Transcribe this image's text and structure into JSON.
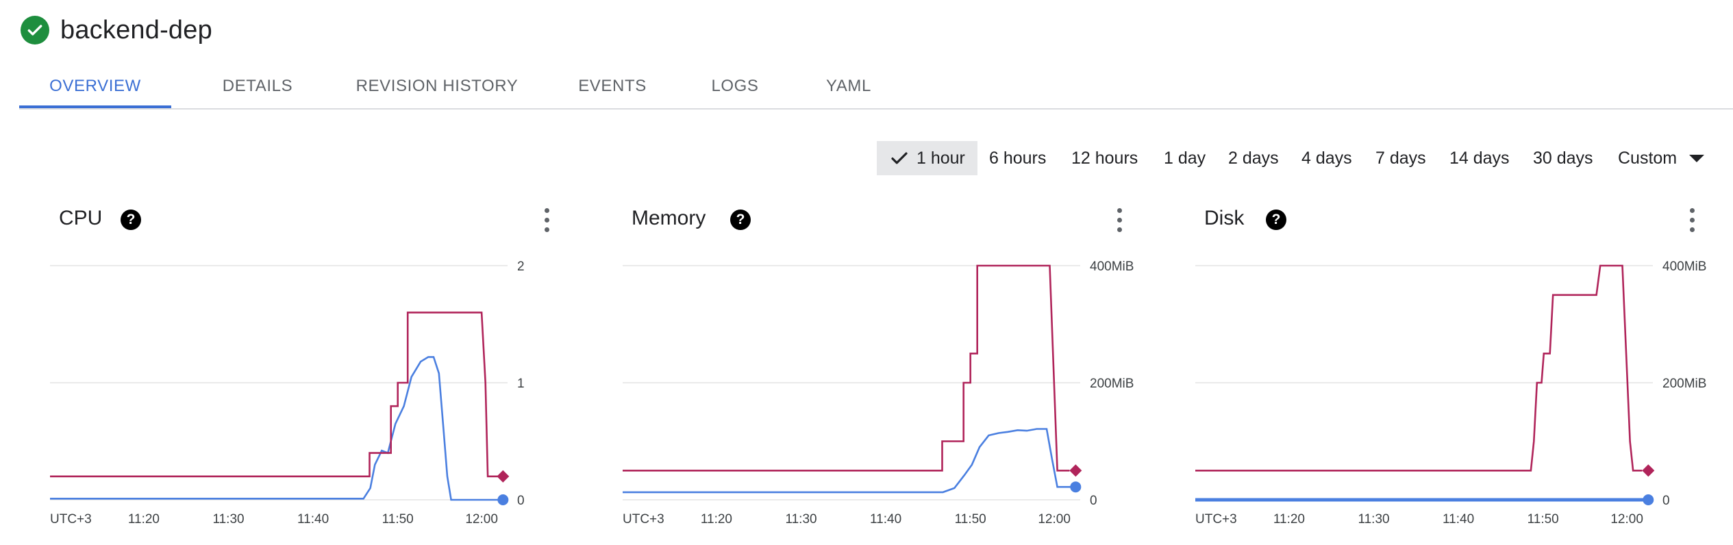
{
  "header": {
    "title": "backend-dep",
    "status_icon": "check-circle-icon",
    "status_color": "#1e8e3e"
  },
  "tabs": [
    {
      "label": "OVERVIEW",
      "active": true
    },
    {
      "label": "DETAILS"
    },
    {
      "label": "REVISION HISTORY"
    },
    {
      "label": "EVENTS"
    },
    {
      "label": "LOGS"
    },
    {
      "label": "YAML"
    }
  ],
  "time_range": {
    "selected": "1 hour",
    "options": [
      "1 hour",
      "6 hours",
      "12 hours",
      "1 day",
      "2 days",
      "4 days",
      "7 days",
      "14 days",
      "30 days",
      "Custom"
    ]
  },
  "colors": {
    "series_a": "#b0245a",
    "series_b": "#4a7fe0",
    "grid": "#e3e3e3",
    "accent": "#3b6fd4"
  },
  "chart_data": [
    {
      "type": "line",
      "title": "CPU",
      "xlabel": "UTC+3",
      "x_ticks": [
        "UTC+3",
        "11:20",
        "11:30",
        "11:40",
        "11:50",
        "12:00"
      ],
      "y_ticks": [
        "2",
        "1",
        "0"
      ],
      "ylim": [
        0,
        2
      ],
      "x_unit": "minutes",
      "xlim": [
        0,
        60
      ],
      "grid": true,
      "series": [
        {
          "values": [
            [
              0,
              0.2
            ],
            [
              41.9,
              0.2
            ],
            [
              41.9,
              0.4
            ],
            [
              44.7,
              0.4
            ],
            [
              44.7,
              0.8
            ],
            [
              45.6,
              0.8
            ],
            [
              45.6,
              1.0
            ],
            [
              46.9,
              1.0
            ],
            [
              46.9,
              1.6
            ],
            [
              56.6,
              1.6
            ],
            [
              57.1,
              1.0
            ],
            [
              57.4,
              0.2
            ],
            [
              58.7,
              0.2
            ]
          ]
        },
        {
          "values": [
            [
              0,
              0.01
            ],
            [
              41.1,
              0.01
            ],
            [
              42,
              0.1
            ],
            [
              42.6,
              0.3
            ],
            [
              43.5,
              0.42
            ],
            [
              44.3,
              0.4
            ],
            [
              45.3,
              0.65
            ],
            [
              46.4,
              0.8
            ],
            [
              47.4,
              1.05
            ],
            [
              48.6,
              1.18
            ],
            [
              49.6,
              1.22
            ],
            [
              50.3,
              1.22
            ],
            [
              51,
              1.08
            ],
            [
              51.6,
              0.6
            ],
            [
              52.1,
              0.2
            ],
            [
              52.6,
              0
            ],
            [
              59.4,
              0
            ]
          ]
        }
      ],
      "end_points": [
        [
          59.4,
          0.2
        ],
        [
          59.4,
          0
        ]
      ]
    },
    {
      "type": "line",
      "title": "Memory",
      "xlabel": "UTC+3",
      "x_ticks": [
        "UTC+3",
        "11:20",
        "11:30",
        "11:40",
        "11:50",
        "12:00"
      ],
      "y_ticks": [
        "400MiB",
        "200MiB",
        "0"
      ],
      "ylim": [
        0,
        400
      ],
      "x_unit": "minutes",
      "xlim": [
        0,
        60
      ],
      "grid": true,
      "series": [
        {
          "values": [
            [
              0,
              50
            ],
            [
              41.9,
              50
            ],
            [
              41.9,
              100
            ],
            [
              44.7,
              100
            ],
            [
              44.7,
              200
            ],
            [
              45.6,
              200
            ],
            [
              45.6,
              250
            ],
            [
              46.5,
              250
            ],
            [
              46.5,
              400
            ],
            [
              56,
              400
            ],
            [
              57,
              50
            ],
            [
              58.6,
              50
            ]
          ]
        },
        {
          "values": [
            [
              0,
              13
            ],
            [
              42,
              13
            ],
            [
              43.5,
              20
            ],
            [
              44.8,
              42
            ],
            [
              45.8,
              60
            ],
            [
              46.8,
              90
            ],
            [
              48,
              110
            ],
            [
              49.3,
              114
            ],
            [
              50.5,
              116
            ],
            [
              51.8,
              119
            ],
            [
              53,
              118
            ],
            [
              54.3,
              121
            ],
            [
              55.6,
              121
            ],
            [
              56.3,
              70
            ],
            [
              57,
              22
            ],
            [
              59.4,
              22
            ]
          ]
        }
      ],
      "end_points": [
        [
          59.4,
          50
        ],
        [
          59.4,
          22
        ]
      ]
    },
    {
      "type": "line",
      "title": "Disk",
      "xlabel": "UTC+3",
      "x_ticks": [
        "UTC+3",
        "11:20",
        "11:30",
        "11:40",
        "11:50",
        "12:00"
      ],
      "y_ticks": [
        "400MiB",
        "200MiB",
        "0"
      ],
      "ylim": [
        0,
        400
      ],
      "x_unit": "minutes",
      "xlim": [
        0,
        60
      ],
      "grid": true,
      "series": [
        {
          "values": [
            [
              0,
              50
            ],
            [
              44,
              50
            ],
            [
              44.4,
              100
            ],
            [
              44.8,
              200
            ],
            [
              45.4,
              200
            ],
            [
              45.7,
              250
            ],
            [
              46.5,
              250
            ],
            [
              46.9,
              350
            ],
            [
              52.6,
              350
            ],
            [
              53.1,
              400
            ],
            [
              56,
              400
            ],
            [
              57,
              100
            ],
            [
              57.4,
              50
            ],
            [
              58.6,
              50
            ]
          ]
        },
        {
          "values": [
            [
              0,
              0
            ],
            [
              59.4,
              0
            ]
          ]
        }
      ],
      "end_points": [
        [
          59.4,
          50
        ],
        [
          59.4,
          0
        ]
      ]
    }
  ]
}
